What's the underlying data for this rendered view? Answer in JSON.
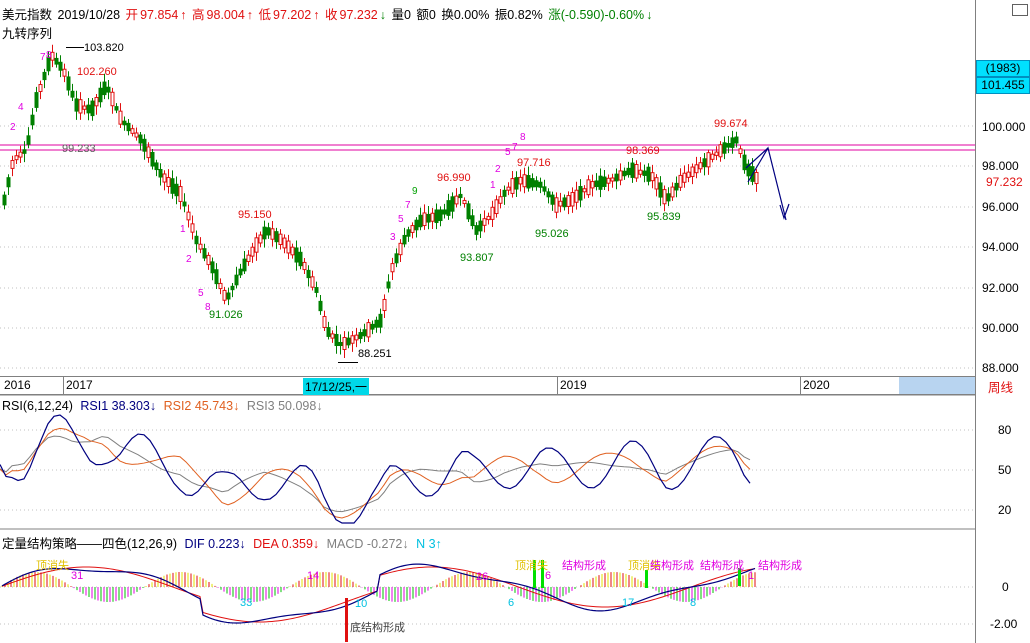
{
  "header": {
    "name": "美元指数",
    "date": "2019/10/28",
    "open_label": "开",
    "open": "97.854",
    "high_label": "高",
    "high": "98.004",
    "low_label": "低",
    "low": "97.202",
    "close_label": "收",
    "close": "97.232",
    "volume": "量0",
    "amount": "额0",
    "turnover": "换0.00%",
    "amplitude": "振0.82%",
    "change": "涨(-0.590)-0.60%"
  },
  "indicator_name": "九转序列",
  "price_axis": [
    "100.000",
    "98.000",
    "96.000",
    "94.000",
    "92.000",
    "90.000",
    "88.000"
  ],
  "current_price": "97.232",
  "cursor_badge": {
    "count": "(1983)",
    "price": "101.455"
  },
  "price_annotations": [
    {
      "text": "103.820"
    },
    {
      "text": "102.260"
    },
    {
      "text": "99.233"
    },
    {
      "text": "95.150"
    },
    {
      "text": "91.026"
    },
    {
      "text": "88.251"
    },
    {
      "text": "96.990"
    },
    {
      "text": "93.807"
    },
    {
      "text": "97.716"
    },
    {
      "text": "95.026"
    },
    {
      "text": "98.369"
    },
    {
      "text": "95.839"
    },
    {
      "text": "99.674"
    }
  ],
  "time_axis": {
    "labels": [
      "2016",
      "2017",
      "2019",
      "2020"
    ],
    "cursor_date": "17/12/25,一",
    "period": "周线"
  },
  "rsi": {
    "title": "RSI(6,12,24)",
    "rsi1": "RSI1 38.303↓",
    "rsi2": "RSI2 45.743↓",
    "rsi3": "RSI3 50.098↓",
    "axis": [
      "80",
      "50",
      "20"
    ]
  },
  "macd": {
    "title": "定量结构策略——四色(12,26,9)",
    "dif": "DIF 0.223↓",
    "dea": "DEA 0.359↓",
    "macd": "MACD -0.272↓",
    "n": "N 3↑",
    "axis": [
      "0",
      "-2.00"
    ],
    "labels": [
      "顶消失",
      "31",
      "14",
      "33",
      "10",
      "底结构形成",
      "26",
      "顶消失",
      "结构形成",
      "6",
      "6",
      "顶消失",
      "结构形成",
      "17",
      "结构形成",
      "8",
      "结构形成",
      "1"
    ]
  },
  "colors": {
    "up": "#e01010",
    "down": "#008000",
    "rsi1": "#000080",
    "rsi2": "#e06020",
    "rsi3": "#808080",
    "td": "#e000e0"
  }
}
